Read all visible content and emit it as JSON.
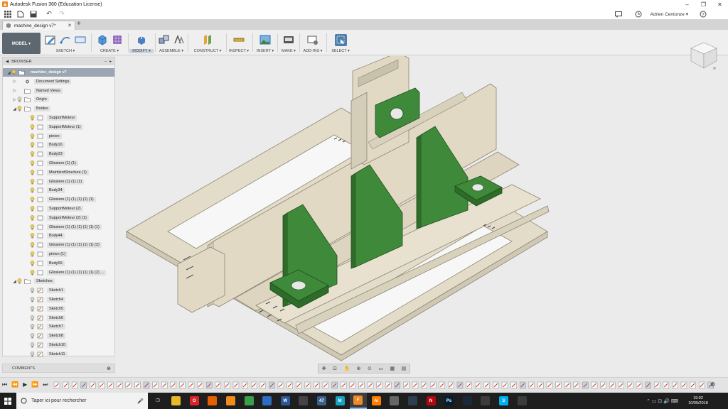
{
  "window": {
    "title": "Autodesk Fusion 360 (Education License)",
    "controls": [
      "–",
      "❐",
      "✕"
    ]
  },
  "qabar": {
    "user_name": "Adrien Centonze ▾"
  },
  "document_tab": {
    "name": "machine_design v7*"
  },
  "ribbon": {
    "workspace_label": "MODEL ▾",
    "groups": [
      {
        "label": "SKETCH ▾"
      },
      {
        "label": "CREATE ▾"
      },
      {
        "label": "MODIFY ▾"
      },
      {
        "label": "ASSEMBLE ▾"
      },
      {
        "label": "CONSTRUCT ▾"
      },
      {
        "label": "INSPECT ▾"
      },
      {
        "label": "INSERT ▾"
      },
      {
        "label": "MAKE ▾"
      },
      {
        "label": "ADD-INS ▾"
      },
      {
        "label": "SELECT ▾"
      }
    ]
  },
  "browser": {
    "header": "BROWSER",
    "root_label": "machine_design v7",
    "folders": {
      "document_settings": "Document Settings",
      "named_views": "Named Views",
      "origin": "Origin",
      "bodies": "Bodies",
      "sketches": "Sketches"
    },
    "bodies": [
      "SupportMoteur",
      "SupportMoteur (1)",
      "pinion",
      "Body16",
      "Body23",
      "Glissiere (1) (1)",
      "MaintientStructure (1)",
      "Glissiere (1) (1) (1)",
      "Body34",
      "Glissiere (1) (1) (1) (1) (1)",
      "SupportMoteur (2)",
      "SupportMoteur (2) (1)",
      "Glissiere (1) (1) (1) (1) (1) (1)",
      "Body44",
      "Glissiere (1) (1) (1) (1) (1) (2)",
      "pinion (1)",
      "Body59",
      "Glissiere (1) (1) (1) (1) (1) (2) ..."
    ],
    "sketches": [
      "Sketch1",
      "Sketch4",
      "Sketch5",
      "Sketch6",
      "Sketch7",
      "Sketch8",
      "Sketch10",
      "Sketch11"
    ]
  },
  "comments": {
    "label": "COMMENTS"
  },
  "taskbar": {
    "search_placeholder": "Taper ici pour rechercher",
    "time": "19:02",
    "date": "10/05/2018",
    "apps": [
      {
        "name": "task-view",
        "color": "#1e1e1e",
        "text": "❐"
      },
      {
        "name": "explorer",
        "color": "#e8b72c",
        "text": ""
      },
      {
        "name": "opera",
        "color": "#d9222a",
        "text": "O"
      },
      {
        "name": "firefox",
        "color": "#e66000",
        "text": ""
      },
      {
        "name": "app-orange",
        "color": "#f28b1d",
        "text": ""
      },
      {
        "name": "chrome",
        "color": "#3a9f4b",
        "text": ""
      },
      {
        "name": "store",
        "color": "#2b6cc4",
        "text": ""
      },
      {
        "name": "word",
        "color": "#2b579a",
        "text": "W"
      },
      {
        "name": "app-dark",
        "color": "#444444",
        "text": ""
      },
      {
        "name": "app-badge",
        "color": "#3b5f8f",
        "text": "47"
      },
      {
        "name": "app-m",
        "color": "#17a3c4",
        "text": "M"
      },
      {
        "name": "fusion",
        "color": "#f08a24",
        "text": "F"
      },
      {
        "name": "illustrator",
        "color": "#ff7c00",
        "text": "Ai"
      },
      {
        "name": "app-grey",
        "color": "#666666",
        "text": ""
      },
      {
        "name": "app-grid",
        "color": "#2f3e4e",
        "text": ""
      },
      {
        "name": "netflix",
        "color": "#b20710",
        "text": "N"
      },
      {
        "name": "photoshop",
        "color": "#001e36",
        "text": "Ps"
      },
      {
        "name": "steam",
        "color": "#1b2838",
        "text": ""
      },
      {
        "name": "app-cap",
        "color": "#3c3c3c",
        "text": ""
      },
      {
        "name": "skype",
        "color": "#00aff0",
        "text": "S"
      },
      {
        "name": "app-chat",
        "color": "#3c3c3c",
        "text": ""
      }
    ]
  },
  "colors": {
    "model_beige": "#e3dcc9",
    "model_green": "#3f8a3a",
    "ui_header": "#5d6770"
  }
}
